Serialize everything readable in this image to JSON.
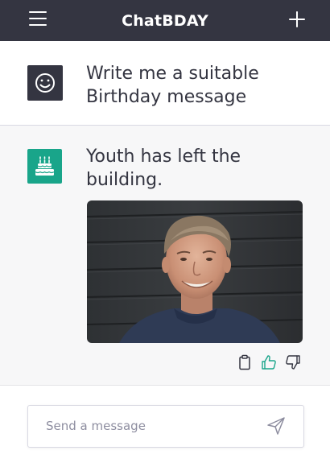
{
  "header": {
    "title": "ChatBDAY",
    "menu_icon": "hamburger-menu-icon",
    "new_chat_icon": "plus-icon",
    "background": "#343541"
  },
  "conversation": {
    "user_message": {
      "avatar_icon": "smiley-face-icon",
      "text": "Write me a suitable Birthday message"
    },
    "bot_message": {
      "avatar_icon": "birthday-cake-icon",
      "avatar_color": "#19a58a",
      "text": "Youth has left the building.",
      "image": "photo of a smiling middle-aged man"
    },
    "actions": [
      {
        "icon": "clipboard-icon"
      },
      {
        "icon": "thumbs-up-icon",
        "color": "#19a58a"
      },
      {
        "icon": "thumbs-down-icon"
      }
    ]
  },
  "composer": {
    "placeholder": "Send a message",
    "send_icon": "send-icon"
  }
}
